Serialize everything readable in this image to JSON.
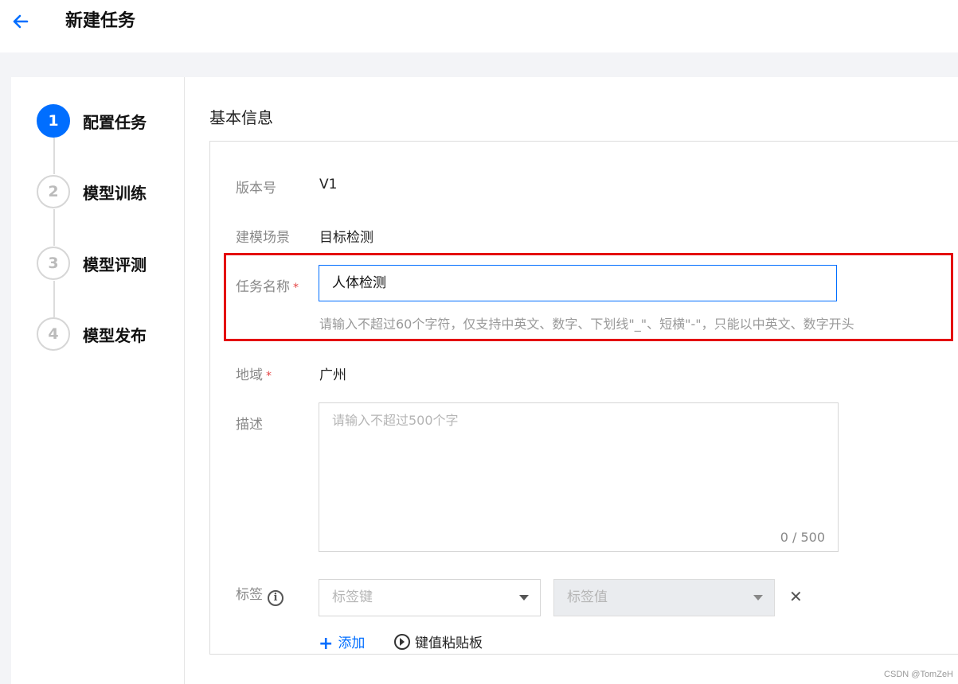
{
  "header": {
    "title": "新建任务"
  },
  "steps": [
    {
      "number": "1",
      "label": "配置任务"
    },
    {
      "number": "2",
      "label": "模型训练"
    },
    {
      "number": "3",
      "label": "模型评测"
    },
    {
      "number": "4",
      "label": "模型发布"
    }
  ],
  "section": {
    "title": "基本信息"
  },
  "form": {
    "version": {
      "label": "版本号",
      "value": "V1"
    },
    "scene": {
      "label": "建模场景",
      "value": "目标检测"
    },
    "task_name": {
      "label": "任务名称",
      "required_mark": "*",
      "value": "人体检测",
      "hint": "请输入不超过60个字符，仅支持中英文、数字、下划线\"_\"、短横\"-\"，只能以中英文、数字开头"
    },
    "region": {
      "label": "地域",
      "required_mark": "*",
      "value": "广州"
    },
    "description": {
      "label": "描述",
      "placeholder": "请输入不超过500个字",
      "counter": "0 / 500"
    },
    "tags": {
      "label": "标签",
      "key_placeholder": "标签键",
      "value_placeholder": "标签值",
      "add_label": "添加",
      "paste_label": "键值粘贴板"
    }
  },
  "watermark": "CSDN @TomZeH",
  "colors": {
    "primary": "#006eff",
    "highlight": "#e4000f",
    "required": "#e54545"
  },
  "icons": {
    "back": "arrow-left-icon",
    "info": "info-icon",
    "close": "close-icon",
    "add": "plus-icon",
    "paste": "play-circle-icon",
    "dropdown": "caret-down-icon"
  }
}
